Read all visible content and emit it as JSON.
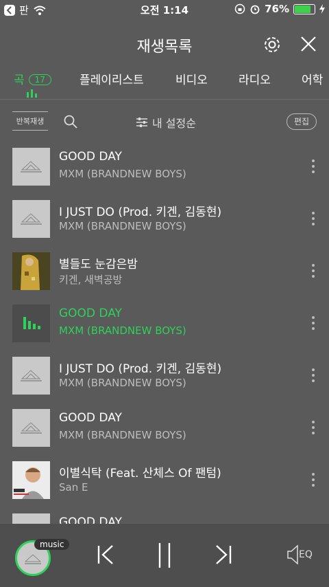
{
  "status": {
    "carrier": "판",
    "time": "오전 1:14",
    "battery": "76%"
  },
  "header": {
    "title": "재생목록"
  },
  "tabs": [
    {
      "label": "곡",
      "count": "17"
    },
    {
      "label": "플레이리스트"
    },
    {
      "label": "비디오"
    },
    {
      "label": "라디오"
    },
    {
      "label": "어학"
    }
  ],
  "toolbar": {
    "repeat": "반복재생",
    "sort": "내 설정순",
    "edit": "편집"
  },
  "songs": [
    {
      "title": "GOOD DAY",
      "artist": "MXM (BRANDNEW BOYS)"
    },
    {
      "title": "I JUST DO (Prod. 키겐, 김동현)",
      "artist": "MXM (BRANDNEW BOYS)"
    },
    {
      "title": "별들도 눈감은밤",
      "artist": "키겐, 새벽공방"
    },
    {
      "title": "GOOD DAY",
      "artist": "MXM (BRANDNEW BOYS)"
    },
    {
      "title": "I JUST DO (Prod. 키겐, 김동현)",
      "artist": "MXM (BRANDNEW BOYS)"
    },
    {
      "title": "GOOD DAY",
      "artist": "MXM (BRANDNEW BOYS)"
    },
    {
      "title": "이별식탁 (Feat. 산체스 Of 팬텀)",
      "artist": "San E"
    },
    {
      "title": "GOOD DAY",
      "artist": ""
    }
  ],
  "player": {
    "label": "music",
    "eq": "EQ"
  },
  "colors": {
    "accent": "#2fd15a"
  }
}
